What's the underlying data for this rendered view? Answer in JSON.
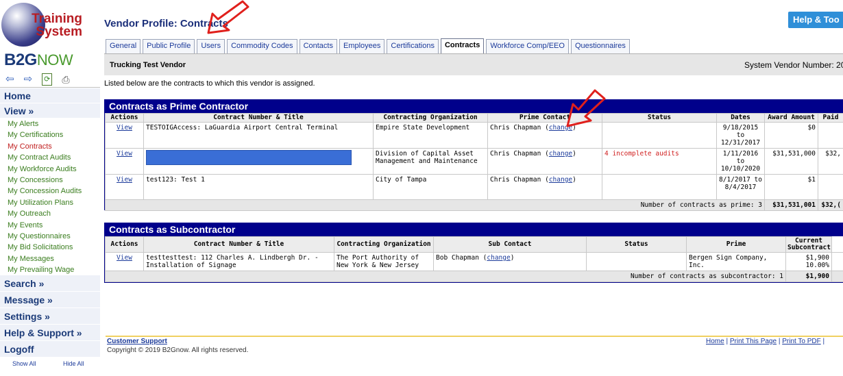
{
  "logo": {
    "training": "Training",
    "system": "System",
    "b2g": "B2G",
    "now": "NOW"
  },
  "toolbar": {
    "back_icon": "back-arrow-icon",
    "forward_icon": "forward-arrow-icon",
    "refresh_icon": "refresh-icon",
    "print_icon": "print-icon"
  },
  "nav": {
    "home": "Home",
    "view": "View »",
    "items": [
      {
        "label": "My Alerts"
      },
      {
        "label": "My Certifications"
      },
      {
        "label": "My Contracts",
        "active": true
      },
      {
        "label": "My Contract Audits"
      },
      {
        "label": "My Workforce Audits"
      },
      {
        "label": "My Concessions"
      },
      {
        "label": "My Concession Audits"
      },
      {
        "label": "My Utilization Plans"
      },
      {
        "label": "My Outreach"
      },
      {
        "label": "My Events"
      },
      {
        "label": "My Questionnaires"
      },
      {
        "label": "My Bid Solicitations"
      },
      {
        "label": "My Messages"
      },
      {
        "label": "My Prevailing Wage"
      }
    ],
    "search": "Search »",
    "message": "Message »",
    "settings": "Settings »",
    "help": "Help & Support »",
    "logoff": "Logoff",
    "show_all": "Show All",
    "hide_all": "Hide All"
  },
  "header": {
    "title": "Vendor Profile: Contracts",
    "help_button": "Help & Too"
  },
  "tabs": [
    {
      "label": "General"
    },
    {
      "label": "Public Profile"
    },
    {
      "label": "Users"
    },
    {
      "label": "Commodity Codes"
    },
    {
      "label": "Contacts"
    },
    {
      "label": "Employees"
    },
    {
      "label": "Certifications"
    },
    {
      "label": "Contracts",
      "active": true
    },
    {
      "label": "Workforce Comp/EEO"
    },
    {
      "label": "Questionnaires"
    }
  ],
  "vendor": {
    "name": "Trucking Test Vendor",
    "system_number_label": "System Vendor Number: 20"
  },
  "intro": "Listed below are the contracts to which this vendor is assigned.",
  "prime": {
    "heading": "Contracts as Prime Contractor",
    "columns": [
      "Actions",
      "Contract Number & Title",
      "Contracting Organization",
      "Prime Contact",
      "Status",
      "Dates",
      "Award Amount",
      "Paid"
    ],
    "rows": [
      {
        "action": "View",
        "title": "TESTOIGAccess: LaGuardia Airport Central Terminal",
        "org": "Empire State Development",
        "contact": "Chris Chapman",
        "change": "change",
        "status": "",
        "dates": "9/18/2015 to 12/31/2017",
        "award": "$0",
        "paid": ""
      },
      {
        "action": "View",
        "title": "",
        "redacted": true,
        "org": "Division of Capital Asset Management and Maintenance",
        "contact": "Chris Chapman",
        "change": "change",
        "status": "4 incomplete audits",
        "dates": "1/11/2016 to 10/10/2020",
        "award": "$31,531,000",
        "paid": "$32,"
      },
      {
        "action": "View",
        "title": "test123: Test 1",
        "org": "City of Tampa",
        "contact": "Chris Chapman",
        "change": "change",
        "status": "",
        "dates": "8/1/2017 to 8/4/2017",
        "award": "$1",
        "paid": ""
      }
    ],
    "summary_label": "Number of contracts as prime: 3",
    "summary_award": "$31,531,001",
    "summary_paid": "$32,("
  },
  "sub": {
    "heading": "Contracts as Subcontractor",
    "columns": [
      "Actions",
      "Contract Number & Title",
      "Contracting Organization",
      "Sub Contact",
      "Status",
      "Prime",
      "Current Subcontract"
    ],
    "rows": [
      {
        "action": "View",
        "title": "testtesttest: 112 Charles A. Lindbergh Dr. - Installation of Signage",
        "org": "The Port Authority of New York & New Jersey",
        "contact": "Bob Chapman",
        "change": "change",
        "status": "",
        "prime": "Bergen Sign Company, Inc.",
        "amount": "$1,900",
        "pct": "10.00%"
      }
    ],
    "summary_label": "Number of contracts as subcontractor: 1",
    "summary_amount": "$1,900"
  },
  "footer": {
    "customer_support": "Customer Support",
    "copyright": "Copyright © 2019 B2Gnow. All rights reserved.",
    "home": "Home",
    "print_page": "Print This Page",
    "print_pdf": "Print To PDF"
  },
  "colors": {
    "accent_navy": "#00008b",
    "nav_green": "#3a7d1e",
    "nav_active": "#c02020",
    "help_blue": "#2f8fd8",
    "annotation_red": "#e0201c"
  }
}
